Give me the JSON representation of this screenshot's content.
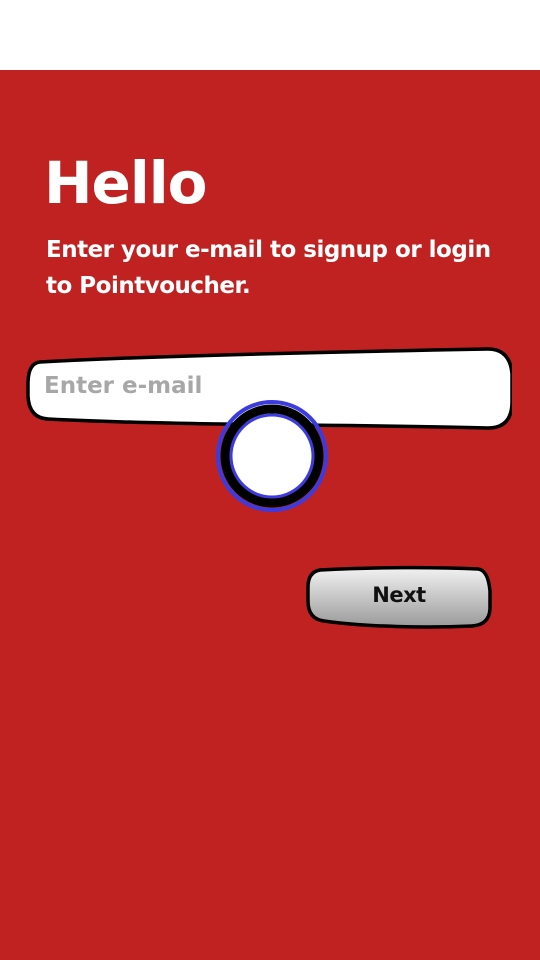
{
  "screen": {
    "title": "Hello",
    "subtitle": "Enter your e-mail to signup or login to Pointvoucher."
  },
  "email_field": {
    "placeholder": "Enter e-mail",
    "value": ""
  },
  "next_button": {
    "label": "Next"
  },
  "colors": {
    "background": "#c02222",
    "touch_indicator": "#3b3bdf"
  }
}
